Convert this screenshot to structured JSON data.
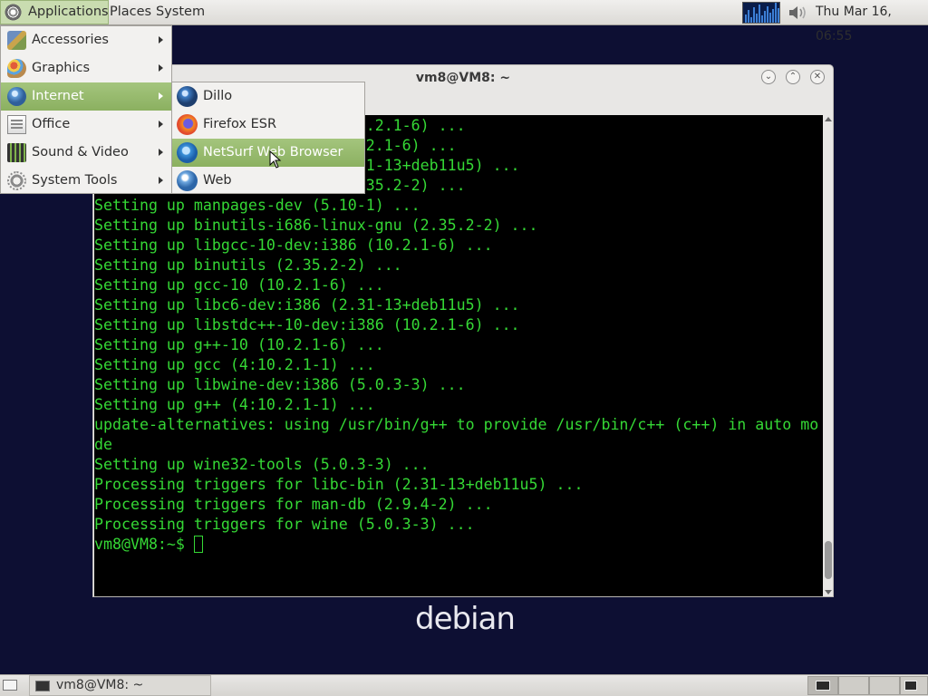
{
  "top_panel": {
    "applications_label": "Applications",
    "places_label": "Places",
    "system_label": "System",
    "clock": "Thu Mar 16, 06:55"
  },
  "apps_menu": {
    "items": [
      {
        "label": "Accessories",
        "icon": "accessories-icon"
      },
      {
        "label": "Graphics",
        "icon": "graphics-icon"
      },
      {
        "label": "Internet",
        "icon": "internet-icon"
      },
      {
        "label": "Office",
        "icon": "office-icon"
      },
      {
        "label": "Sound & Video",
        "icon": "sound-video-icon"
      },
      {
        "label": "System Tools",
        "icon": "system-tools-icon"
      }
    ],
    "highlighted": "Internet"
  },
  "internet_menu": {
    "items": [
      {
        "label": "Dillo",
        "icon": "dillo-icon"
      },
      {
        "label": "Firefox ESR",
        "icon": "firefox-icon"
      },
      {
        "label": "NetSurf Web Browser",
        "icon": "netsurf-icon"
      },
      {
        "label": "Web",
        "icon": "web-icon"
      }
    ],
    "highlighted": "NetSurf Web Browser"
  },
  "terminal": {
    "title": "vm8@VM8: ~",
    "lines": [
      "Setting up libstdc++6:i386 (10.2.1-6) ...",
      "Setting up libgcc-s1:i386 (10.2.1-6) ...",
      "Setting up libc6-dev:i386 (2.31-13+deb11u5) ...",
      "Setting up binutils-common (2.35.2-2) ...",
      "Setting up manpages-dev (5.10-1) ...",
      "Setting up binutils-i686-linux-gnu (2.35.2-2) ...",
      "Setting up libgcc-10-dev:i386 (10.2.1-6) ...",
      "Setting up binutils (2.35.2-2) ...",
      "Setting up gcc-10 (10.2.1-6) ...",
      "Setting up libc6-dev:i386 (2.31-13+deb11u5) ...",
      "Setting up libstdc++-10-dev:i386 (10.2.1-6) ...",
      "Setting up g++-10 (10.2.1-6) ...",
      "Setting up gcc (4:10.2.1-1) ...",
      "Setting up libwine-dev:i386 (5.0.3-3) ...",
      "Setting up g++ (4:10.2.1-1) ...",
      "update-alternatives: using /usr/bin/g++ to provide /usr/bin/c++ (c++) in auto mo",
      "de",
      "Setting up wine32-tools (5.0.3-3) ...",
      "Processing triggers for libc-bin (2.31-13+deb11u5) ...",
      "Processing triggers for man-db (2.9.4-2) ...",
      "Processing triggers for wine (5.0.3-3) ..."
    ],
    "prompt": "vm8@VM8:~$ "
  },
  "desktop": {
    "logo_text": "debian"
  },
  "bottom_panel": {
    "task_label": "vm8@VM8: ~"
  },
  "colors": {
    "terminal_text": "#35d835",
    "desktop_bg": "#0d0f33",
    "menu_highlight": "#8bb060"
  }
}
